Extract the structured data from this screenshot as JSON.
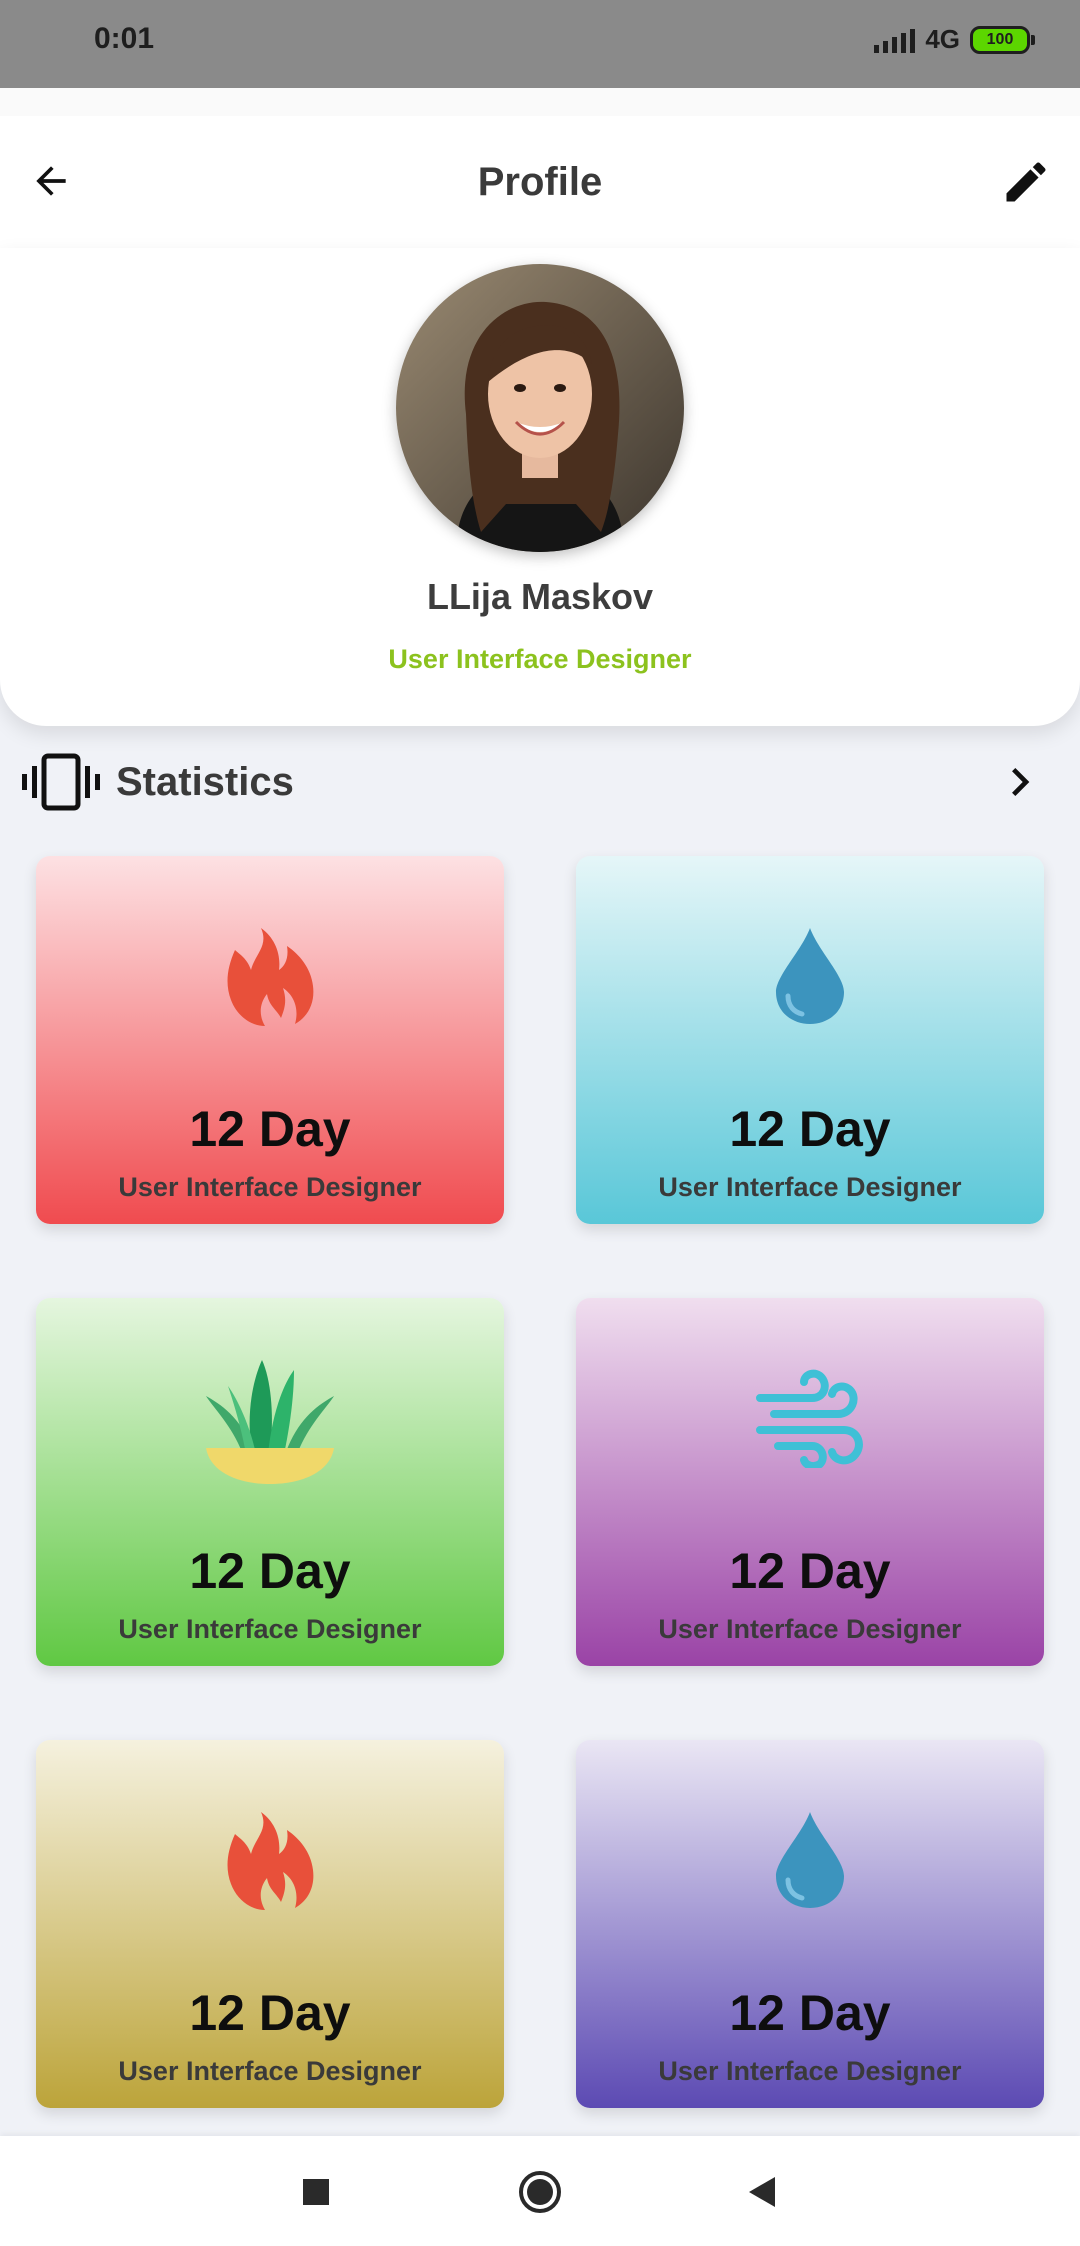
{
  "status_bar": {
    "time": "0:01",
    "network": "4G",
    "battery": "100"
  },
  "app_bar": {
    "title": "Profile",
    "back_icon": "arrow-left-icon",
    "edit_icon": "pencil-icon"
  },
  "profile": {
    "name": "LLija Maskov",
    "role": "User Interface Designer",
    "role_color": "#8CC21E"
  },
  "statistics": {
    "title": "Statistics",
    "icon": "vibration-icon",
    "chevron": "chevron-right-icon",
    "cards": [
      {
        "value": "12 Day",
        "label": "User Interface Designer",
        "icon": "flame-icon",
        "color": "#F04B4F"
      },
      {
        "value": "12 Day",
        "label": "User Interface Designer",
        "icon": "water-drop-icon",
        "color": "#59C7D8"
      },
      {
        "value": "12 Day",
        "label": "User Interface Designer",
        "icon": "grass-icon",
        "color": "#60C843"
      },
      {
        "value": "12 Day",
        "label": "User Interface Designer",
        "icon": "wind-icon",
        "color": "#9A43A6"
      },
      {
        "value": "12 Day",
        "label": "User Interface Designer",
        "icon": "flame-icon",
        "color": "#BCA43A"
      },
      {
        "value": "12 Day",
        "label": "User Interface Designer",
        "icon": "water-drop-icon",
        "color": "#5C4AB3"
      }
    ]
  },
  "nav_bar": {
    "recent_icon": "square-icon",
    "home_icon": "circle-icon",
    "back_icon": "triangle-back-icon"
  }
}
